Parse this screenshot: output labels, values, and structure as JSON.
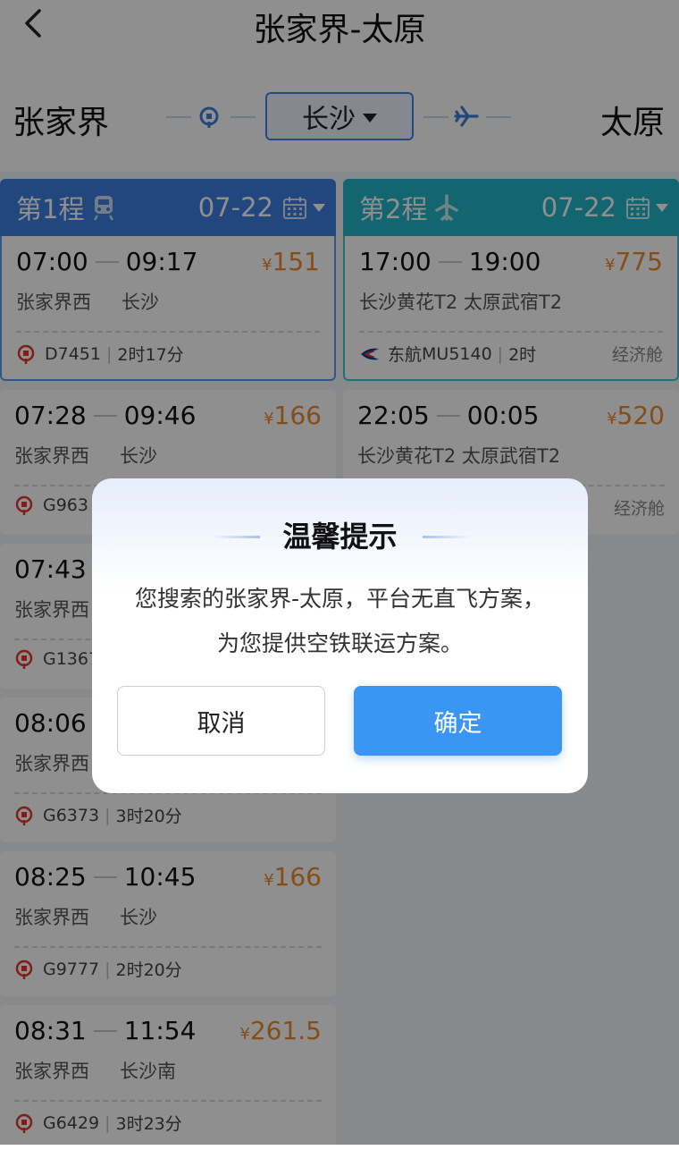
{
  "header": {
    "title": "张家界-太原"
  },
  "route": {
    "origin": "张家界",
    "transfer": "长沙",
    "destination": "太原"
  },
  "legs": [
    {
      "title": "第1程",
      "date": "07-22",
      "mode_icon": "train-icon",
      "options": [
        {
          "depart": "07:00",
          "arrive": "09:17",
          "price": "151",
          "from": "张家界西",
          "to": "长沙",
          "number": "D7451",
          "duration": "2时17分",
          "selected": true
        },
        {
          "depart": "07:28",
          "arrive": "09:46",
          "price": "166",
          "from": "张家界西",
          "to": "长沙",
          "number": "G963"
        },
        {
          "depart": "07:43",
          "from": "张家界西",
          "number": "G1367"
        },
        {
          "depart": "08:06",
          "from": "张家界西",
          "number": "G6373",
          "duration": "3时20分"
        },
        {
          "depart": "08:25",
          "arrive": "10:45",
          "price": "166",
          "from": "张家界西",
          "to": "长沙",
          "number": "G9777",
          "duration": "2时20分"
        },
        {
          "depart": "08:31",
          "arrive": "11:54",
          "price": "261.5",
          "from": "张家界西",
          "to": "长沙南",
          "number": "G6429",
          "duration": "3时23分"
        }
      ]
    },
    {
      "title": "第2程",
      "date": "07-22",
      "mode_icon": "plane-icon",
      "options": [
        {
          "depart": "17:00",
          "arrive": "19:00",
          "price": "775",
          "from": "长沙黄花T2",
          "to": "太原武宿T2",
          "airline": "东航",
          "number": "MU5140",
          "duration": "2时",
          "cabin": "经济舱",
          "selected": true
        },
        {
          "depart": "22:05",
          "arrive": "00:05",
          "price": "520",
          "from": "长沙黄花T2",
          "to": "太原武宿T2",
          "cabin": "经济舱"
        }
      ]
    }
  ],
  "currency": "¥",
  "dialog": {
    "title": "温馨提示",
    "message": "您搜索的张家界-太原，平台无直飞方案，为您提供空铁联运方案。",
    "cancel_label": "取消",
    "confirm_label": "确定"
  },
  "colors": {
    "accent": "#3d7fe0",
    "flight": "#22b5c8",
    "price": "#f08a2c",
    "confirm": "#3b96f3"
  }
}
